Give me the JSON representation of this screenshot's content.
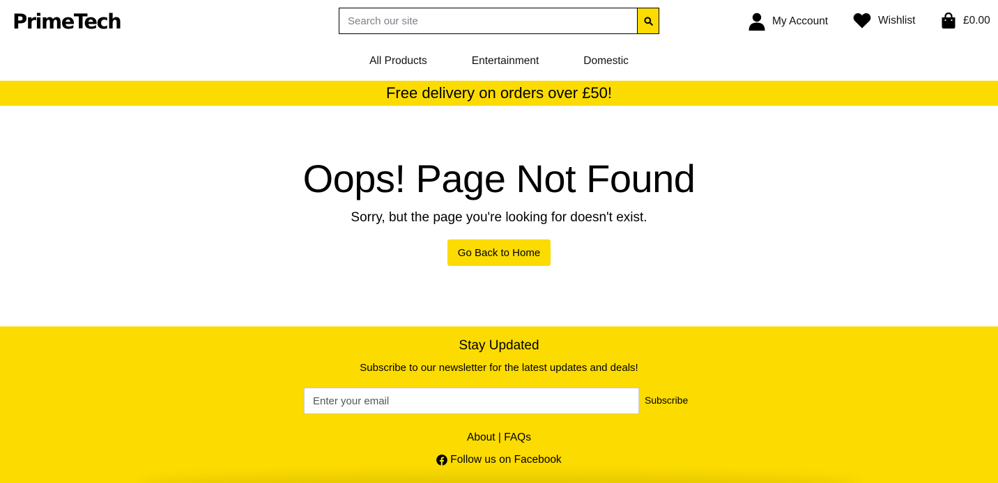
{
  "header": {
    "logo": "PrimeTech",
    "search_placeholder": "Search our site",
    "account_label": "My Account",
    "wishlist_label": "Wishlist",
    "cart_total": "£0.00"
  },
  "nav": {
    "items": [
      "All Products",
      "Entertainment",
      "Domestic"
    ]
  },
  "banner": {
    "text": "Free delivery on orders over £50!"
  },
  "main": {
    "title": "Oops! Page Not Found",
    "subtitle": "Sorry, but the page you're looking for doesn't exist.",
    "home_button": "Go Back to Home"
  },
  "footer": {
    "title": "Stay Updated",
    "subtitle": "Subscribe to our newsletter for the latest updates and deals!",
    "email_placeholder": "Enter your email",
    "subscribe_label": "Subscribe",
    "about_label": "About",
    "separator": "|",
    "faqs_label": "FAQs",
    "facebook_label": "Follow us on Facebook"
  },
  "colors": {
    "accent": "#fcdb00",
    "text": "#000000"
  },
  "icons": {
    "search": "search-icon",
    "account": "user-icon",
    "wishlist": "heart-icon",
    "cart": "shopping-bag-icon",
    "facebook": "facebook-icon"
  }
}
